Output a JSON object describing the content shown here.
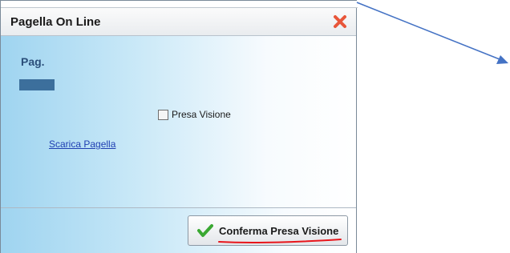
{
  "window": {
    "title": "Pagella On Line"
  },
  "content": {
    "icon_text": "Pag.",
    "download_link": "Scarica Pagella",
    "checkbox_label": "Presa Visione",
    "checkbox_checked": false
  },
  "footer": {
    "confirm_label": "Conferma Presa Visione"
  },
  "colors": {
    "close_icon": "#e8563a",
    "check_icon": "#3aa832",
    "annotation_arrow": "#4472c4",
    "annotation_underline": "#e8151b"
  }
}
